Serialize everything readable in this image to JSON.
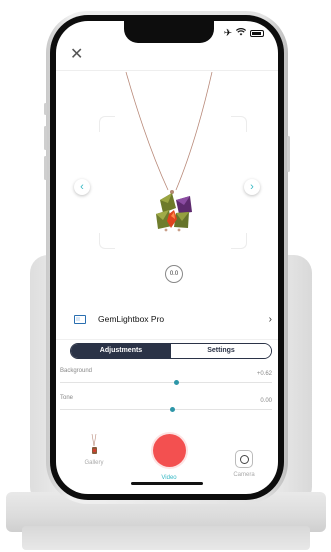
{
  "colors": {
    "accent": "#35b8c4",
    "record": "#f35050",
    "segment_dark": "#2b3347",
    "slider_knob": "#2e96a8"
  },
  "header": {
    "close_icon": "close-icon"
  },
  "preview": {
    "zoom_label": "0.0",
    "left_arrow": "chevron-left-icon",
    "right_arrow": "chevron-right-icon"
  },
  "device": {
    "name": "GemLightbox Pro",
    "icon": "lightbox-icon",
    "chevron": "chevron-right-icon"
  },
  "tabs": [
    {
      "label": "Adjustments",
      "active": true
    },
    {
      "label": "Settings",
      "active": false
    }
  ],
  "sliders": [
    {
      "label": "Background",
      "value": "+0.62",
      "position": 0.62
    },
    {
      "label": "Tone",
      "value": "0.00",
      "position": 0.5
    }
  ],
  "toolbar": {
    "gallery_label": "Gallery",
    "video_label": "Video",
    "camera_label": "Camera"
  }
}
